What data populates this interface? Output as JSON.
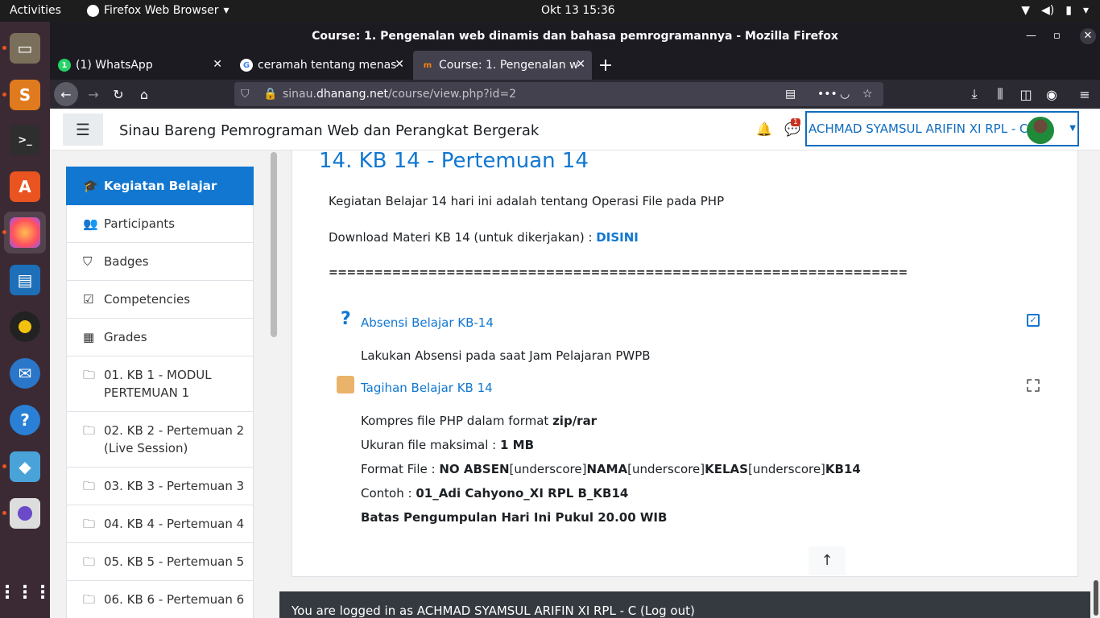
{
  "topbar": {
    "activities": "Activities",
    "app": "Firefox Web Browser",
    "clock": "Okt 13  15:36"
  },
  "window": {
    "title": "Course: 1. Pengenalan web dinamis dan bahasa pemrogramannya - Mozilla Firefox"
  },
  "tabs": [
    {
      "label": "(1) WhatsApp"
    },
    {
      "label": "ceramah tentang menas"
    },
    {
      "label": "Course: 1. Pengenalan w"
    }
  ],
  "url": {
    "host": "sinau.",
    "domain": "dhanang.net",
    "path": "/course/view.php?id=2"
  },
  "site": {
    "brand": "Sinau Bareng Pemrograman Web dan Perangkat Bergerak",
    "notif_count": "1",
    "user": "ACHMAD SYAMSUL ARIFIN XI RPL - C"
  },
  "sidebar": {
    "items": [
      {
        "label": "Kegiatan Belajar",
        "icon": "graduation-cap-icon"
      },
      {
        "label": "Participants",
        "icon": "users-icon"
      },
      {
        "label": "Badges",
        "icon": "shield-icon"
      },
      {
        "label": "Competencies",
        "icon": "check-square-icon"
      },
      {
        "label": "Grades",
        "icon": "table-icon"
      },
      {
        "label": "01. KB 1 - MODUL PERTEMUAN 1",
        "icon": "folder-icon"
      },
      {
        "label": "02. KB 2 - Pertemuan 2 (Live Session)",
        "icon": "folder-icon"
      },
      {
        "label": "03. KB 3 - Pertemuan 3",
        "icon": "folder-icon"
      },
      {
        "label": "04. KB 4 - Pertemuan 4",
        "icon": "folder-icon"
      },
      {
        "label": "05. KB 5 - Pertemuan 5",
        "icon": "folder-icon"
      },
      {
        "label": "06. KB 6 - Pertemuan 6",
        "icon": "folder-icon"
      }
    ]
  },
  "content": {
    "section_title": "14. KB 14 - Pertemuan 14",
    "intro": "Kegiatan Belajar 14 hari ini adalah tentang Operasi File pada PHP",
    "download_prefix": "Download Materi KB 14 (untuk dikerjakan) : ",
    "download_link": "DISINI",
    "separator": "================================================================",
    "act1": "Absensi Belajar KB-14",
    "act1_desc": "Lakukan Absensi pada saat Jam Pelajaran PWPB",
    "act2": "Tagihan Belajar KB 14",
    "l1a": "Kompres file PHP dalam format ",
    "l1b": "zip/rar",
    "l2a": "Ukuran file maksimal : ",
    "l2b": "1 MB",
    "l3a": "Format File : ",
    "l3b": "NO ABSEN",
    "l3c": "[underscore]",
    "l3d": "NAMA",
    "l3e": "[underscore]",
    "l3f": "KELAS",
    "l3g": "[underscore]",
    "l3h": "KB14",
    "l4a": "Contoh : ",
    "l4b": "01_Adi Cahyono_XI RPL B_KB14",
    "l5": "Batas Pengumpulan Hari Ini Pukul 20.00 WIB"
  },
  "footer": "You are logged in as ACHMAD SYAMSUL ARIFIN XI RPL - C (Log out)"
}
